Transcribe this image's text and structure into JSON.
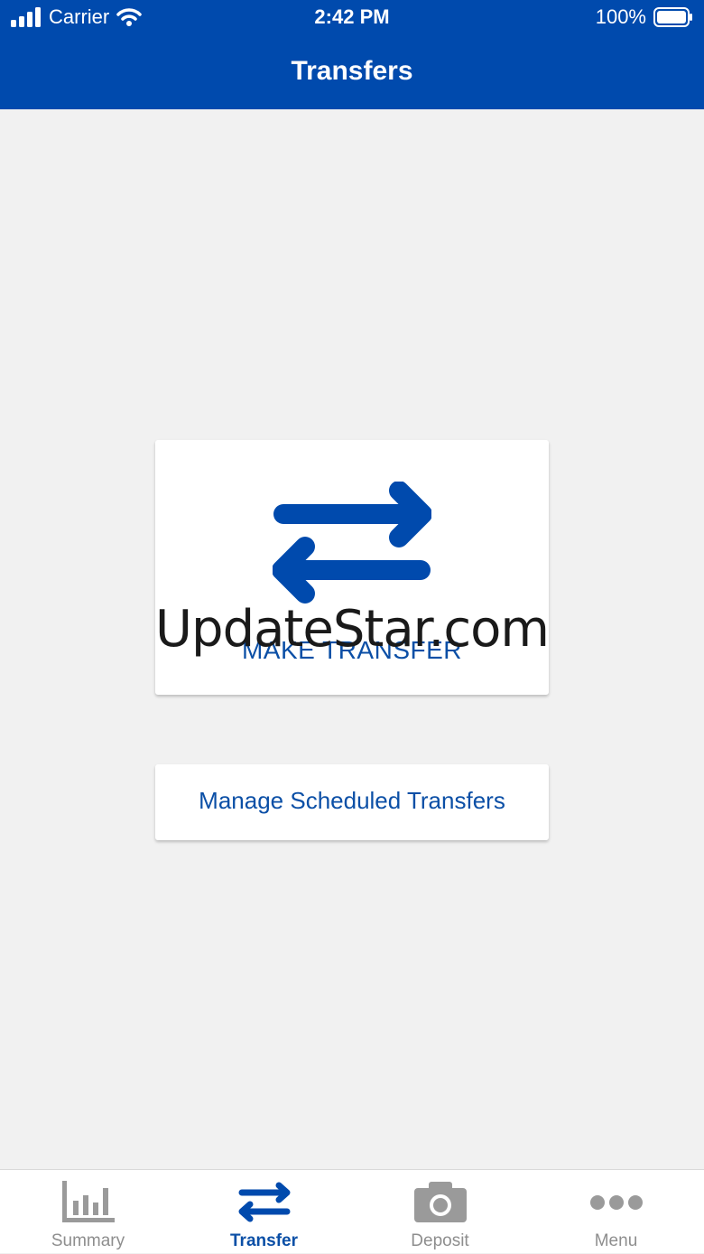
{
  "status_bar": {
    "carrier": "Carrier",
    "time": "2:42 PM",
    "battery": "100%"
  },
  "header": {
    "title": "Transfers"
  },
  "colors": {
    "brand": "#004aad",
    "accent_text": "#0b4fa6",
    "background": "#f1f1f1",
    "inactive_tab": "#8e8e8e"
  },
  "make_transfer": {
    "label": "MAKE TRANSFER",
    "icon": "transfer-arrows-icon"
  },
  "watermark": {
    "text": "UpdateStar.com"
  },
  "manage_scheduled": {
    "label": "Manage Scheduled Transfers"
  },
  "tabs": [
    {
      "label": "Summary",
      "icon": "bar-chart-icon",
      "active": false
    },
    {
      "label": "Transfer",
      "icon": "transfer-arrows-icon",
      "active": true
    },
    {
      "label": "Deposit",
      "icon": "camera-icon",
      "active": false
    },
    {
      "label": "Menu",
      "icon": "more-dots-icon",
      "active": false
    }
  ]
}
